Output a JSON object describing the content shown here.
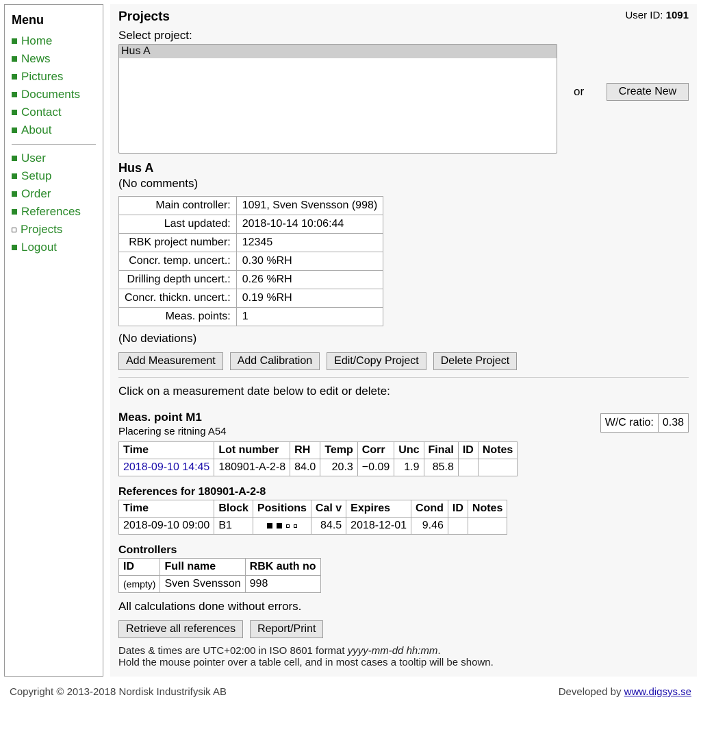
{
  "menu": {
    "title": "Menu",
    "items_top": [
      {
        "label": "Home"
      },
      {
        "label": "News"
      },
      {
        "label": "Pictures"
      },
      {
        "label": "Documents"
      },
      {
        "label": "Contact"
      },
      {
        "label": "About"
      }
    ],
    "items_bottom": [
      {
        "label": "User"
      },
      {
        "label": "Setup"
      },
      {
        "label": "Order"
      },
      {
        "label": "References"
      },
      {
        "label": "Projects",
        "current": true
      },
      {
        "label": "Logout"
      }
    ]
  },
  "header": {
    "title": "Projects",
    "user_id_label": "User ID:",
    "user_id": "1091"
  },
  "select": {
    "label": "Select project:",
    "options": [
      "Hus A"
    ],
    "selected": "Hus A",
    "or_label": "or",
    "create_button": "Create New"
  },
  "project": {
    "name": "Hus A",
    "comments": "(No comments)",
    "details": [
      {
        "label": "Main controller:",
        "value": "1091, Sven Svensson (998)"
      },
      {
        "label": "Last updated:",
        "value": "2018-10-14 10:06:44"
      },
      {
        "label": "RBK project number:",
        "value": "12345"
      },
      {
        "label": "Concr. temp. uncert.:",
        "value": "0.30 %RH"
      },
      {
        "label": "Drilling depth uncert.:",
        "value": "0.26 %RH"
      },
      {
        "label": "Concr. thickn. uncert.:",
        "value": "0.19 %RH"
      },
      {
        "label": "Meas. points:",
        "value": "1"
      }
    ],
    "deviations": "(No deviations)"
  },
  "actions": {
    "add_measurement": "Add Measurement",
    "add_calibration": "Add Calibration",
    "edit_copy": "Edit/Copy Project",
    "delete": "Delete Project"
  },
  "instruction": "Click on a measurement date below to edit or delete:",
  "meas_point": {
    "title": "Meas. point M1",
    "subtitle": "Placering se ritning A54",
    "wc_label": "W/C ratio:",
    "wc_value": "0.38",
    "columns": [
      "Time",
      "Lot number",
      "RH",
      "Temp",
      "Corr",
      "Unc",
      "Final",
      "ID",
      "Notes"
    ],
    "rows": [
      {
        "time": "2018-09-10 14:45",
        "lot": "180901-A-2-8",
        "rh": "84.0",
        "temp": "20.3",
        "corr": "−0.09",
        "unc": "1.9",
        "final": "85.8",
        "id": "",
        "notes": ""
      }
    ]
  },
  "references": {
    "title": "References for 180901-A-2-8",
    "columns": [
      "Time",
      "Block",
      "Positions",
      "Cal v",
      "Expires",
      "Cond",
      "ID",
      "Notes"
    ],
    "rows": [
      {
        "time": "2018-09-10 09:00",
        "block": "B1",
        "positions": [
          true,
          true,
          false,
          false
        ],
        "calv": "84.5",
        "expires": "2018-12-01",
        "cond": "9.46",
        "id": "",
        "notes": ""
      }
    ]
  },
  "controllers": {
    "title": "Controllers",
    "columns": [
      "ID",
      "Full name",
      "RBK auth no"
    ],
    "rows": [
      {
        "id": "(empty)",
        "name": "Sven Svensson",
        "auth": "998"
      }
    ]
  },
  "status": "All calculations done without errors.",
  "bottom_actions": {
    "retrieve": "Retrieve all references",
    "report": "Report/Print"
  },
  "note": {
    "line1_a": "Dates & times are UTC+02:00 in ISO 8601 format ",
    "line1_b": "yyyy-mm-dd hh:mm",
    "line1_c": ".",
    "line2": "Hold the mouse pointer over a table cell, and in most cases a tooltip will be shown."
  },
  "footer": {
    "copyright": "Copyright © 2013-2018 Nordisk Industrifysik AB",
    "developed_by": "Developed by ",
    "link_text": "www.digsys.se"
  }
}
